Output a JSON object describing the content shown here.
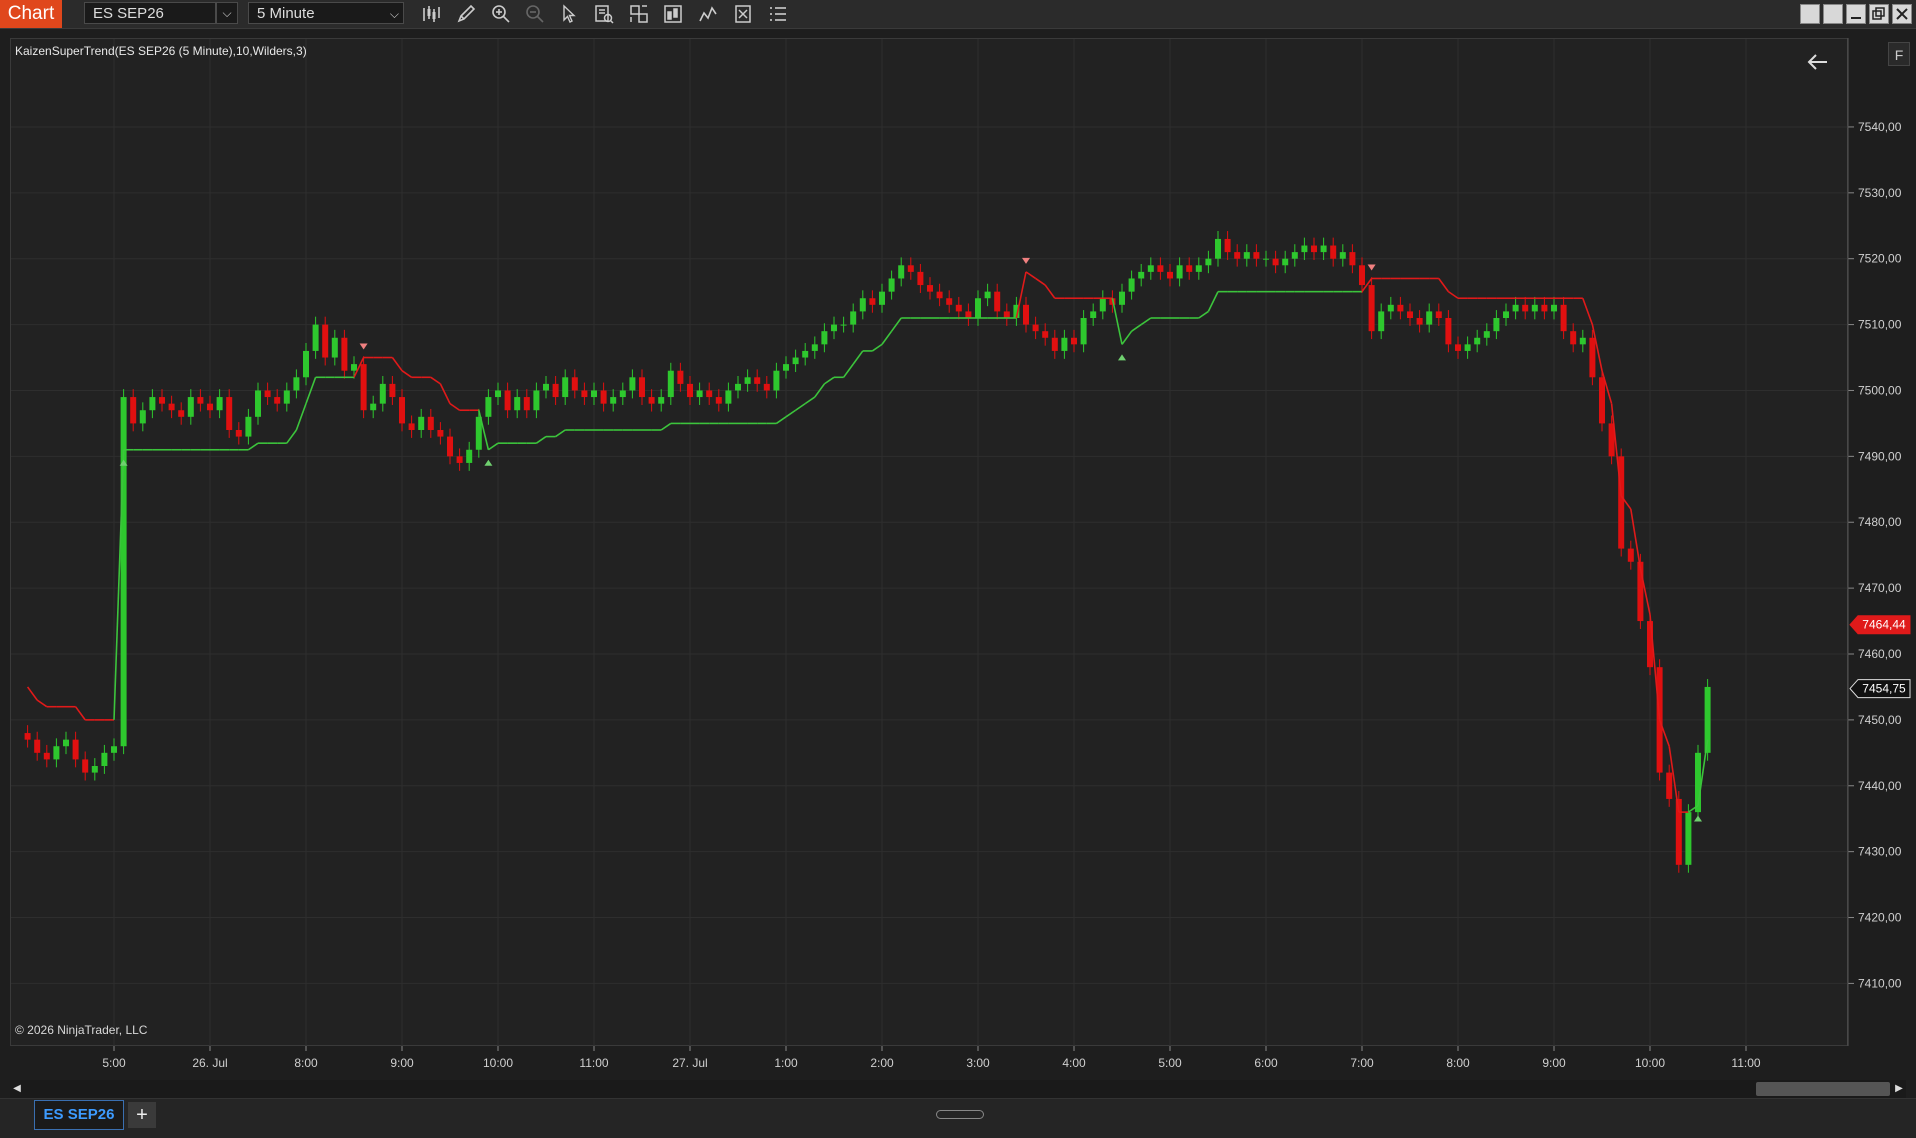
{
  "toolbar": {
    "chart_label": "Chart",
    "instrument": "ES SEP26",
    "interval": "5 Minute",
    "tools": [
      "bar-chart-icon",
      "pencil-icon",
      "zoom-in-icon",
      "zoom-out-icon",
      "pointer-icon",
      "data-box-icon",
      "properties-icon",
      "strategies-icon",
      "indicators-icon",
      "templates-icon",
      "menu-icon"
    ]
  },
  "window_buttons": [
    "tile-icon",
    "tile2-icon",
    "minimize-icon",
    "restore-icon",
    "close-icon"
  ],
  "chart": {
    "indicator_label": "KaizenSuperTrend(ES SEP26 (5 Minute),10,Wilders,3)",
    "copyright": "© 2026 NinjaTrader, LLC",
    "f_button": "F",
    "colors": {
      "background": "#222222",
      "up": "#2ec82e",
      "down": "#e01010",
      "trend_up": "#3cc43c",
      "trend_down": "#e01a1a",
      "grid": "#2e2e2e"
    },
    "price_labels": [
      {
        "text": "7464,44",
        "value": 7464.44,
        "style": "red"
      },
      {
        "text": "7454,75",
        "value": 7454.75,
        "style": "white"
      }
    ]
  },
  "chart_data": {
    "type": "candlestick",
    "title": "",
    "y_ticks": [
      "7540,00",
      "7530,00",
      "7520,00",
      "7510,00",
      "7500,00",
      "7490,00",
      "7480,00",
      "7470,00",
      "7460,00",
      "7450,00",
      "7440,00",
      "7430,00",
      "7420,00",
      "7410,00"
    ],
    "y_tick_values": [
      7540,
      7530,
      7520,
      7510,
      7500,
      7490,
      7480,
      7470,
      7460,
      7450,
      7440,
      7430,
      7420,
      7410
    ],
    "ylim": [
      7400.5,
      7553.5
    ],
    "x_labels": [
      "5:00",
      "26. Jul",
      "8:00",
      "9:00",
      "10:00",
      "11:00",
      "27. Jul",
      "1:00",
      "2:00",
      "3:00",
      "4:00",
      "5:00",
      "6:00",
      "7:00",
      "8:00",
      "9:00",
      "10:00",
      "11:00"
    ],
    "x_label_bars": [
      0,
      10,
      20,
      30,
      40,
      50,
      60,
      70,
      80,
      90,
      100,
      110,
      120,
      130,
      140,
      150,
      160,
      170
    ],
    "bars_start": -9,
    "bars_end": 171,
    "bar_count_between_labels": 10,
    "candles_close": [
      7447,
      7445,
      7444,
      7446,
      7447,
      7444,
      7442,
      7443,
      7445,
      7446,
      7499,
      7495,
      7497,
      7499,
      7498,
      7497,
      7496,
      7499,
      7498,
      7497,
      7499,
      7494,
      7493,
      7496,
      7500,
      7499,
      7498,
      7500,
      7502,
      7506,
      7510,
      7505,
      7508,
      7503,
      7504,
      7497,
      7498,
      7501,
      7499,
      7495,
      7494,
      7496,
      7494,
      7493,
      7490,
      7489,
      7491,
      7496,
      7499,
      7500,
      7497,
      7499,
      7497,
      7500,
      7501,
      7499,
      7502,
      7500,
      7499,
      7500,
      7498,
      7499,
      7500,
      7502,
      7499,
      7498,
      7499,
      7503,
      7501,
      7499,
      7500,
      7499,
      7498,
      7500,
      7501,
      7502,
      7501,
      7500,
      7503,
      7504,
      7505,
      7506,
      7507,
      7509,
      7510,
      7510,
      7512,
      7514,
      7513,
      7515,
      7517,
      7519,
      7518,
      7516,
      7515,
      7514,
      7513,
      7512,
      7511,
      7514,
      7515,
      7512,
      7511,
      7513,
      7510,
      7509,
      7508,
      7506,
      7508,
      7507,
      7511,
      7512,
      7514,
      7513,
      7515,
      7517,
      7518,
      7519,
      7518,
      7517,
      7519,
      7518,
      7519,
      7520,
      7523,
      7521,
      7520,
      7521,
      7520,
      7520,
      7519,
      7520,
      7521,
      7522,
      7521,
      7522,
      7520,
      7521,
      7519,
      7516,
      7509,
      7512,
      7513,
      7512,
      7511,
      7510,
      7512,
      7511,
      7507,
      7506,
      7507,
      7508,
      7509,
      7511,
      7512,
      7513,
      7512,
      7513,
      7512,
      7513,
      7509,
      7507,
      7508,
      7502,
      7495,
      7490,
      7476,
      7474,
      7465,
      7458,
      7442,
      7438,
      7428,
      7436,
      7445,
      7455
    ]
  },
  "bottom": {
    "tab_label": "ES SEP26",
    "add_tab": "+"
  }
}
